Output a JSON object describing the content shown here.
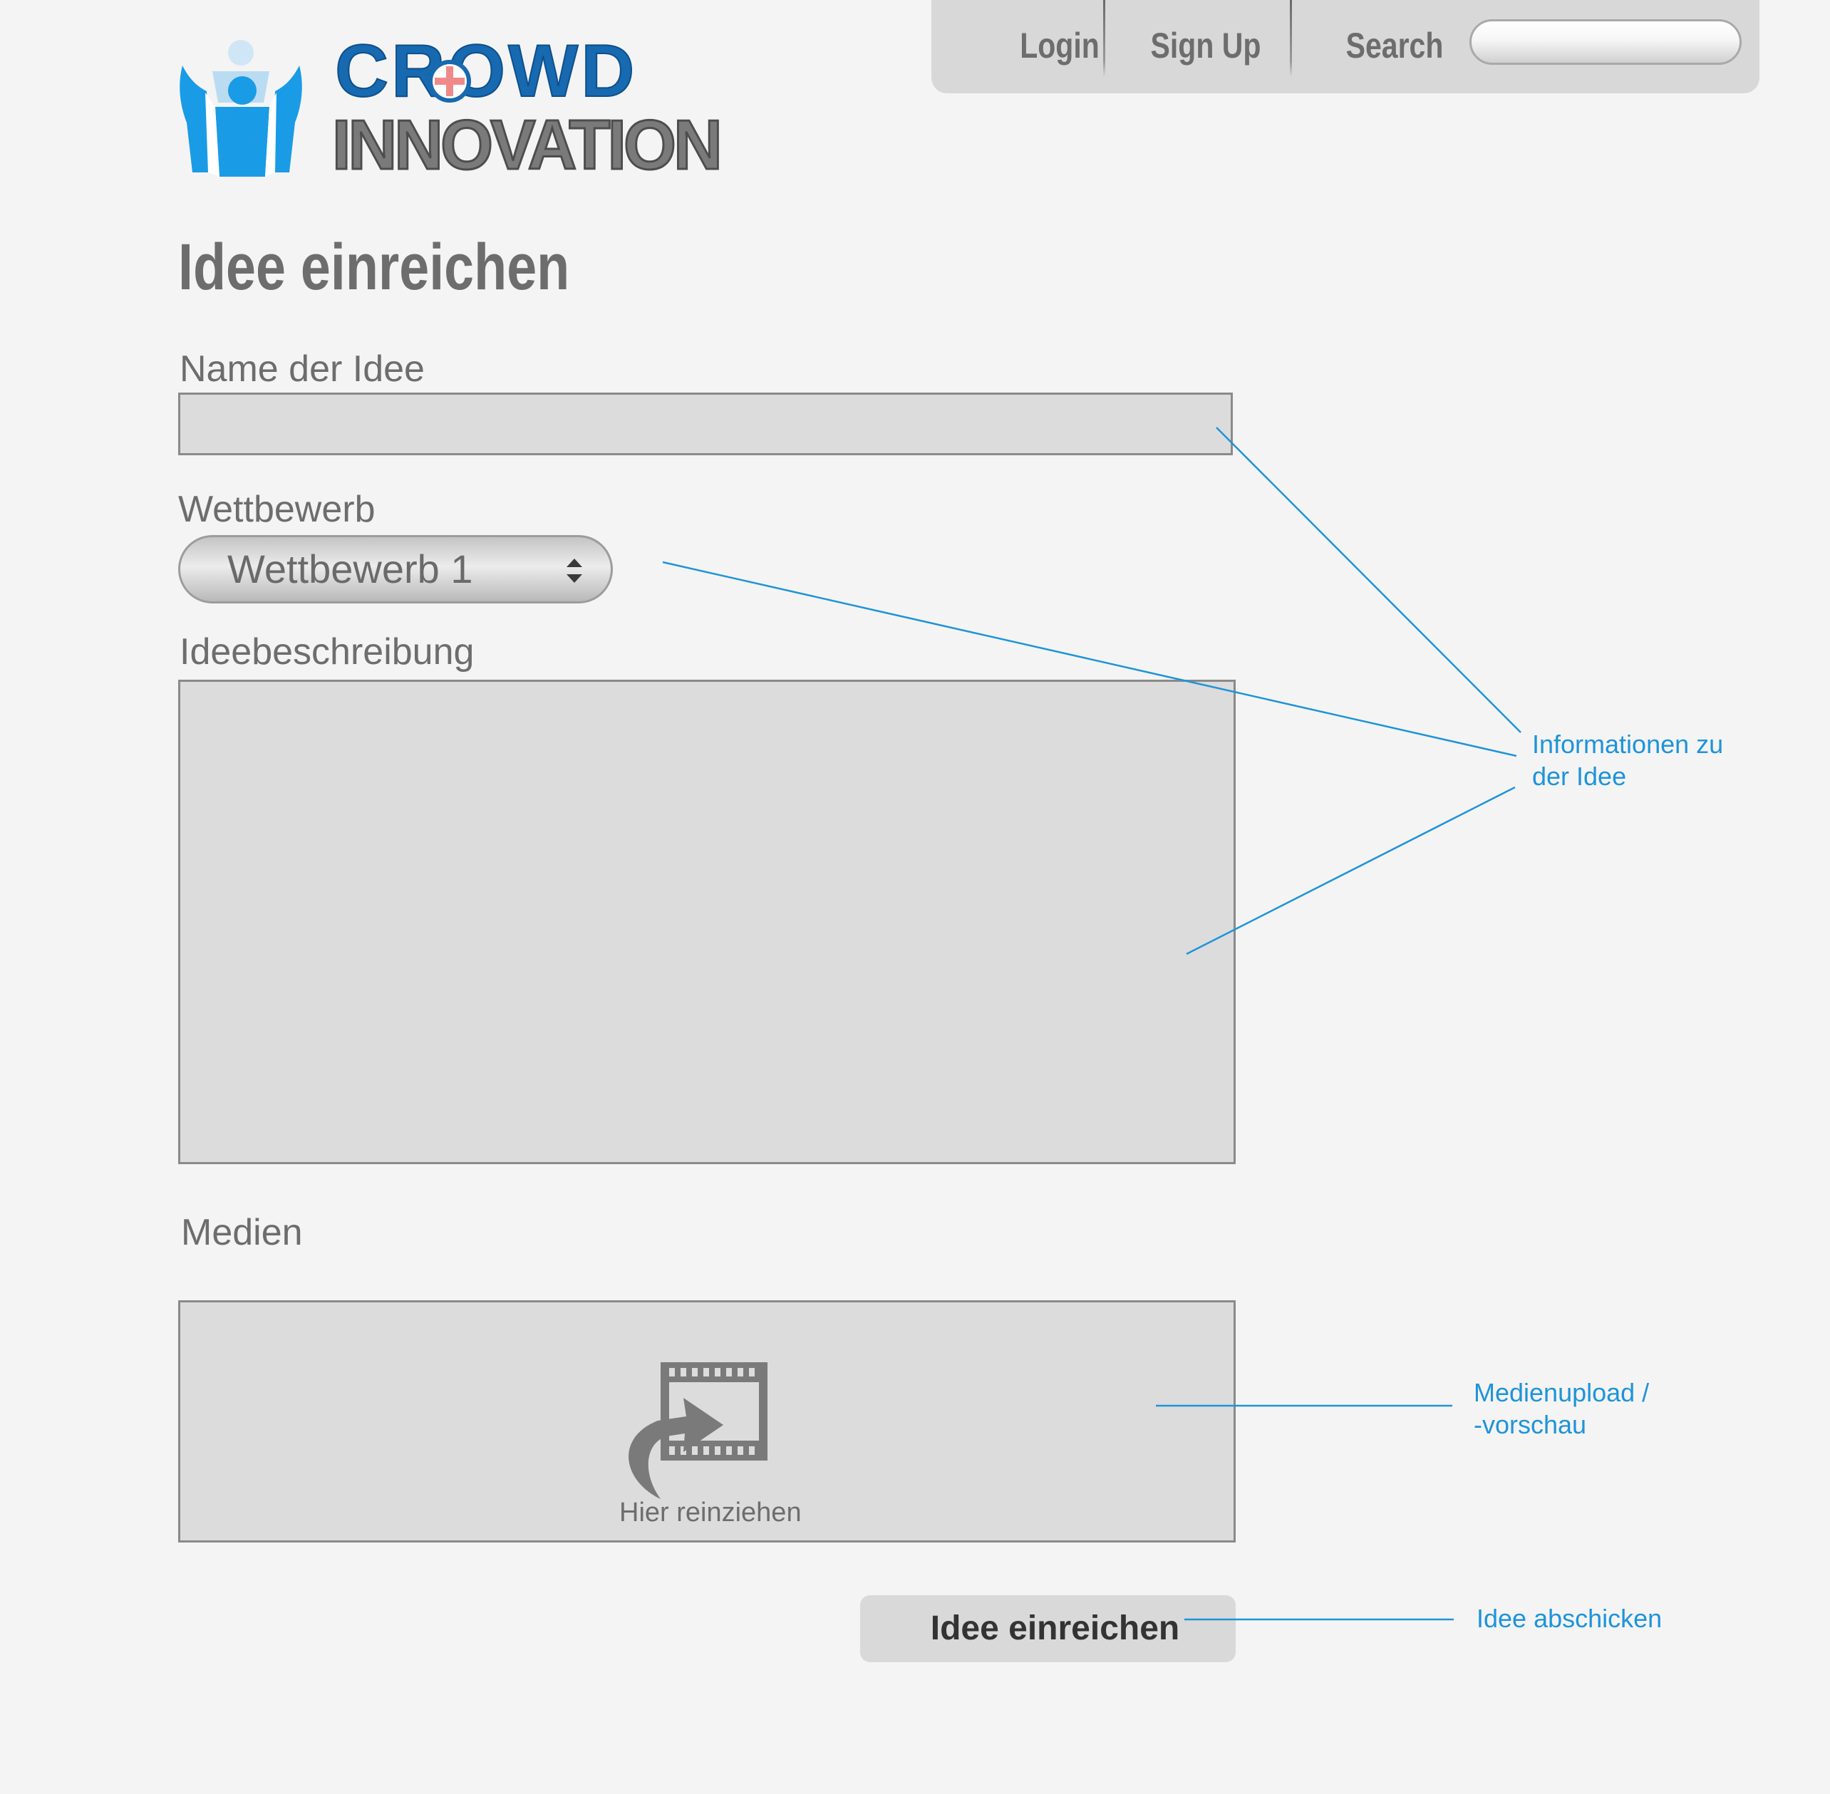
{
  "nav": {
    "login": "Login",
    "signup": "Sign Up",
    "search_label": "Search",
    "search_value": ""
  },
  "logo": {
    "line1": "CROWD",
    "line2": "INNOVATION",
    "colors": {
      "blue": "#1a9be6",
      "dark_blue": "#1769b0",
      "plus": "#f08a8a",
      "gray": "#7a7a7a"
    }
  },
  "page": {
    "title": "Idee einreichen"
  },
  "form": {
    "name_label": "Name der Idee",
    "name_value": "",
    "competition_label": "Wettbewerb",
    "competition_selected": "Wettbewerb 1",
    "description_label": "Ideebeschreibung",
    "description_value": "",
    "media_label": "Medien",
    "dropzone_text": "Hier reinziehen",
    "submit_label": "Idee einreichen"
  },
  "annotations": {
    "info_line1": "Informationen zu",
    "info_line2": "der Idee",
    "media_line1": "Medienupload /",
    "media_line2": "-vorschau",
    "submit": "Idee abschicken",
    "color": "#1e94d9"
  },
  "icons": {
    "logo": "crowd-people-icon",
    "select_arrows": "updown-arrows-icon",
    "upload": "film-drop-icon"
  }
}
